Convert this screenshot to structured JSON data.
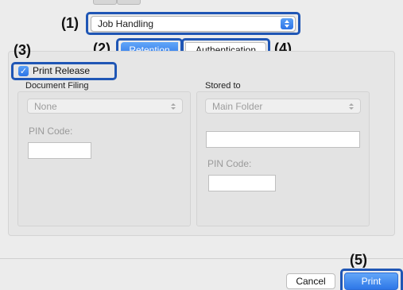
{
  "callouts": {
    "c1": "(1)",
    "c2": "(2)",
    "c3": "(3)",
    "c4": "(4)",
    "c5": "(5)"
  },
  "job_handling_popup": {
    "value": "Job Handling",
    "icon": "up-down-arrows-icon"
  },
  "tabs": [
    {
      "label": "Retention",
      "selected": true
    },
    {
      "label": "Authentication",
      "selected": false
    }
  ],
  "print_release": {
    "label": "Print Release",
    "checked": true
  },
  "document_filing": {
    "heading": "Document Filing",
    "select_value": "None",
    "pin_label": "PIN Code:"
  },
  "stored_to": {
    "heading": "Stored to",
    "select_value": "Main Folder",
    "pin_label": "PIN Code:"
  },
  "buttons": {
    "cancel": "Cancel",
    "print": "Print"
  },
  "colors": {
    "highlight": "#1f56b5",
    "accent": "#2e77e7",
    "background": "#ececec"
  }
}
